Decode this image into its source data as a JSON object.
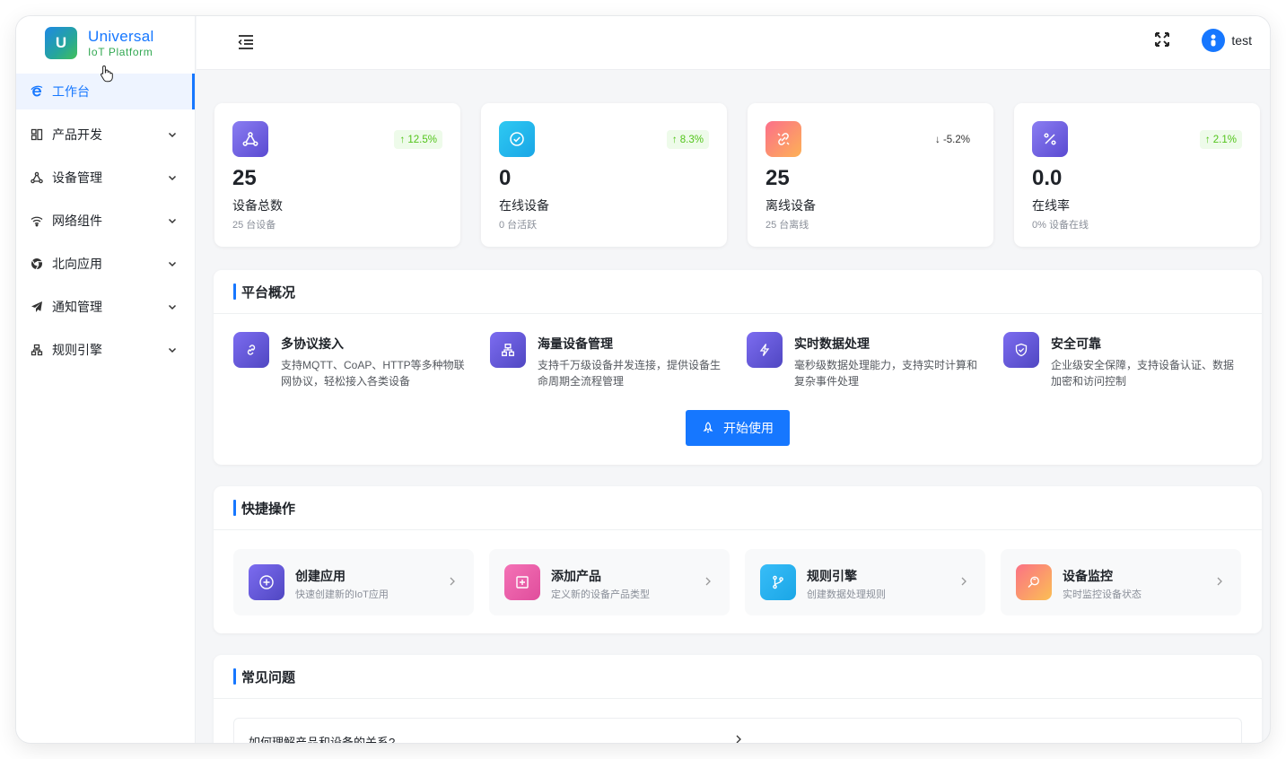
{
  "brand": {
    "logo_letter": "U",
    "name": "Universal",
    "subtitle": "IoT Platform"
  },
  "sidebar": {
    "items": [
      {
        "label": "工作台",
        "icon": "ie-icon",
        "active": true,
        "expandable": false
      },
      {
        "label": "产品开发",
        "icon": "grid-icon",
        "expandable": true
      },
      {
        "label": "设备管理",
        "icon": "nodes-icon",
        "expandable": true
      },
      {
        "label": "网络组件",
        "icon": "wifi-icon",
        "expandable": true
      },
      {
        "label": "北向应用",
        "icon": "chrome-icon",
        "expandable": true
      },
      {
        "label": "通知管理",
        "icon": "send-icon",
        "expandable": true
      },
      {
        "label": "规则引擎",
        "icon": "cluster-icon",
        "expandable": true
      }
    ]
  },
  "header": {
    "user_name": "test"
  },
  "stats": [
    {
      "value": "25",
      "label": "设备总数",
      "sub": "25 台设备",
      "trend": "12.5%",
      "trend_dir": "up",
      "icon": "nodes-icon",
      "color": "#7166e4"
    },
    {
      "value": "0",
      "label": "在线设备",
      "sub": "0 台活跃",
      "trend": "8.3%",
      "trend_dir": "up",
      "icon": "check-circle-icon",
      "color": "#22c1ee"
    },
    {
      "value": "25",
      "label": "离线设备",
      "sub": "25 台离线",
      "trend": "-5.2%",
      "trend_dir": "down",
      "icon": "unlink-icon",
      "color": "#f97b7b"
    },
    {
      "value": "0.0",
      "label": "在线率",
      "sub": "0% 设备在线",
      "trend": "2.1%",
      "trend_dir": "up",
      "icon": "percent-icon",
      "color": "#7166e4"
    }
  ],
  "overview": {
    "title": "平台概况",
    "features": [
      {
        "title": "多协议接入",
        "desc": "支持MQTT、CoAP、HTTP等多种物联网协议，轻松接入各类设备",
        "icon": "link-icon"
      },
      {
        "title": "海量设备管理",
        "desc": "支持千万级设备并发连接，提供设备生命周期全流程管理",
        "icon": "cluster-icon"
      },
      {
        "title": "实时数据处理",
        "desc": "毫秒级数据处理能力，支持实时计算和复杂事件处理",
        "icon": "bolt-icon"
      },
      {
        "title": "安全可靠",
        "desc": "企业级安全保障，支持设备认证、数据加密和访问控制",
        "icon": "shield-icon"
      }
    ],
    "start_button": "开始使用"
  },
  "quick": {
    "title": "快捷操作",
    "actions": [
      {
        "title": "创建应用",
        "sub": "快速创建新的IoT应用",
        "icon": "plus-circle-icon",
        "color": "#6a5cd6"
      },
      {
        "title": "添加产品",
        "sub": "定义新的设备产品类型",
        "icon": "plus-square-icon",
        "color": "#f06aa8"
      },
      {
        "title": "规则引擎",
        "sub": "创建数据处理规则",
        "icon": "branch-icon",
        "color": "#1fb8f0"
      },
      {
        "title": "设备监控",
        "sub": "实时监控设备状态",
        "icon": "monitor-search-icon",
        "color": "#f7845f"
      }
    ]
  },
  "faq": {
    "title": "常见问题",
    "items": [
      {
        "question": "如何理解产品和设备的关系?"
      }
    ]
  }
}
